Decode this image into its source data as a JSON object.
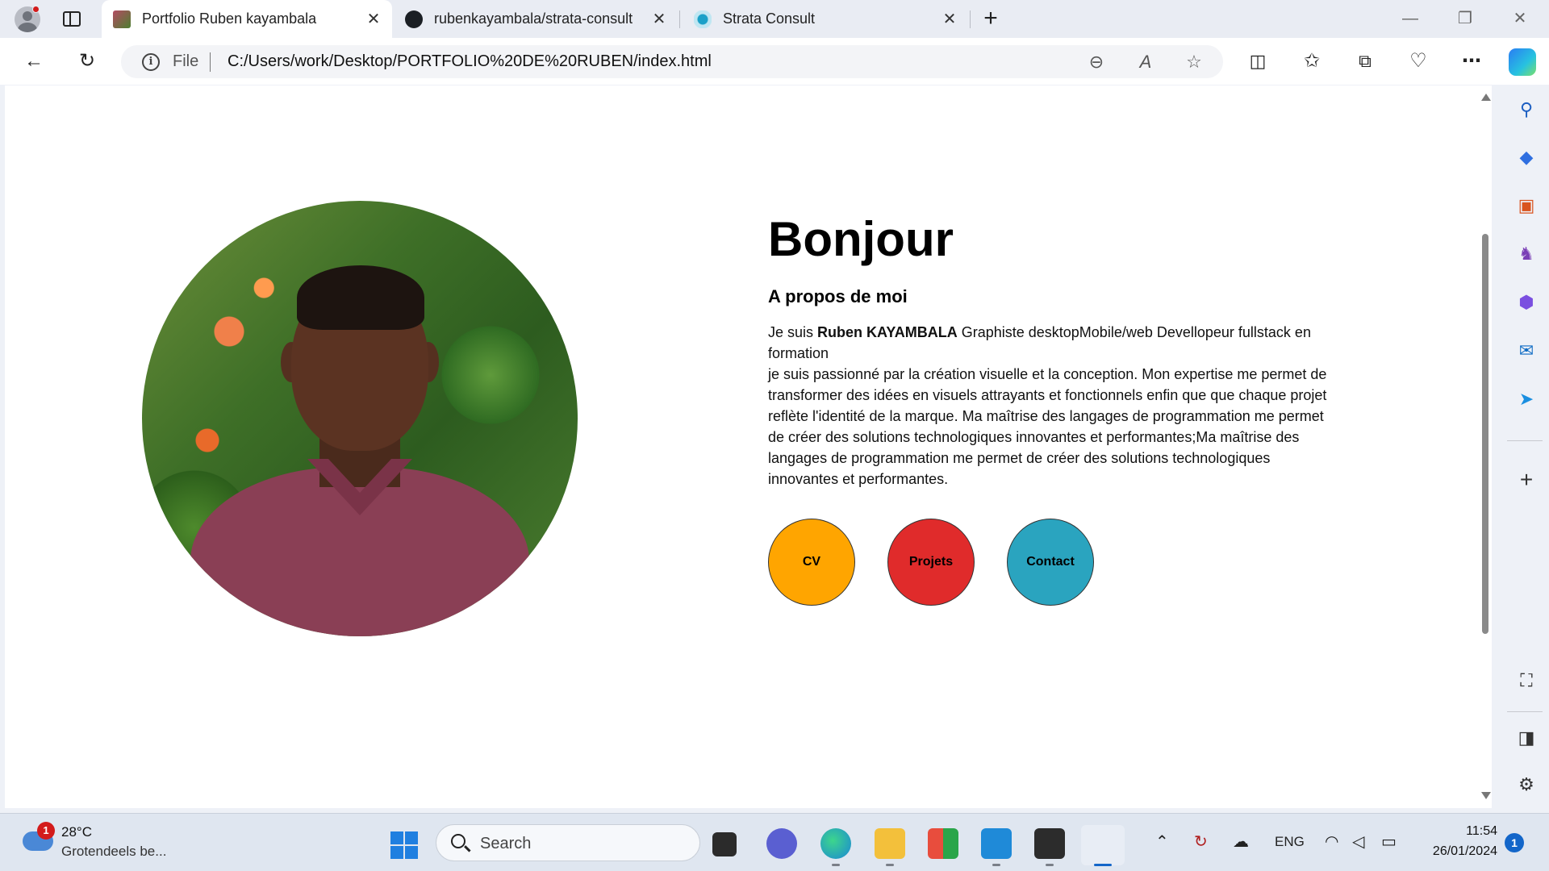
{
  "browser": {
    "tabs": [
      {
        "title": "Portfolio Ruben kayambala",
        "active": true
      },
      {
        "title": "rubenkayambala/strata-consult",
        "active": false
      },
      {
        "title": "Strata Consult",
        "active": false
      }
    ],
    "close_glyph": "✕",
    "new_tab_glyph": "+",
    "address": {
      "scheme_label": "File",
      "url": "C:/Users/work/Desktop/PORTFOLIO%20DE%20RUBEN/index.html"
    },
    "window_controls": {
      "minimize": "—",
      "restore": "❐",
      "close": "✕"
    }
  },
  "page": {
    "greeting": "Bonjour",
    "about_title": "A propos de moi",
    "about_intro_prefix": "Je suis ",
    "about_name": "Ruben KAYAMBALA",
    "about_intro_suffix": " Graphiste desktopMobile/web Devellopeur fullstack en formation",
    "about_body": "je suis passionné par la création visuelle et la conception. Mon expertise me permet de transformer des idées en visuels attrayants et fonctionnels enfin que que chaque projet reflète l'identité de la marque. Ma maîtrise des langages de programmation me permet de créer des solutions technologiques innovantes et performantes;Ma maîtrise des langages de programmation me permet de créer des solutions technologiques innovantes et performantes.",
    "buttons": [
      {
        "label": "CV",
        "color": "#FFA500"
      },
      {
        "label": "Projets",
        "color": "#E02B2B"
      },
      {
        "label": "Contact",
        "color": "#2AA4BF"
      }
    ]
  },
  "taskbar": {
    "weather": {
      "badge": "1",
      "temp": "28°C",
      "desc": "Grotendeels be..."
    },
    "search_label": "Search",
    "tray_lang": "ENG",
    "time": "11:54",
    "date": "26/01/2024",
    "notification_count": "1"
  }
}
